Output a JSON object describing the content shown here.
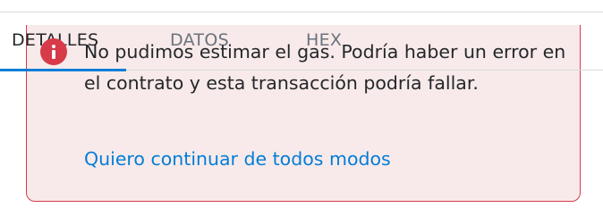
{
  "tabs": [
    {
      "label": "DETALLES",
      "active": true
    },
    {
      "label": "DATOS",
      "active": false
    },
    {
      "label": "HEX",
      "active": false
    }
  ],
  "alert": {
    "severity": "danger",
    "icon": "info-icon",
    "message": "No pudimos estimar el gas. Podría haber un error en el contrato y esta transacción podría fallar.",
    "link_text": "Quiero continuar de todos modos"
  },
  "colors": {
    "accent": "#037dd6",
    "danger": "#d73a49",
    "alert_background": "#f8eaea"
  }
}
